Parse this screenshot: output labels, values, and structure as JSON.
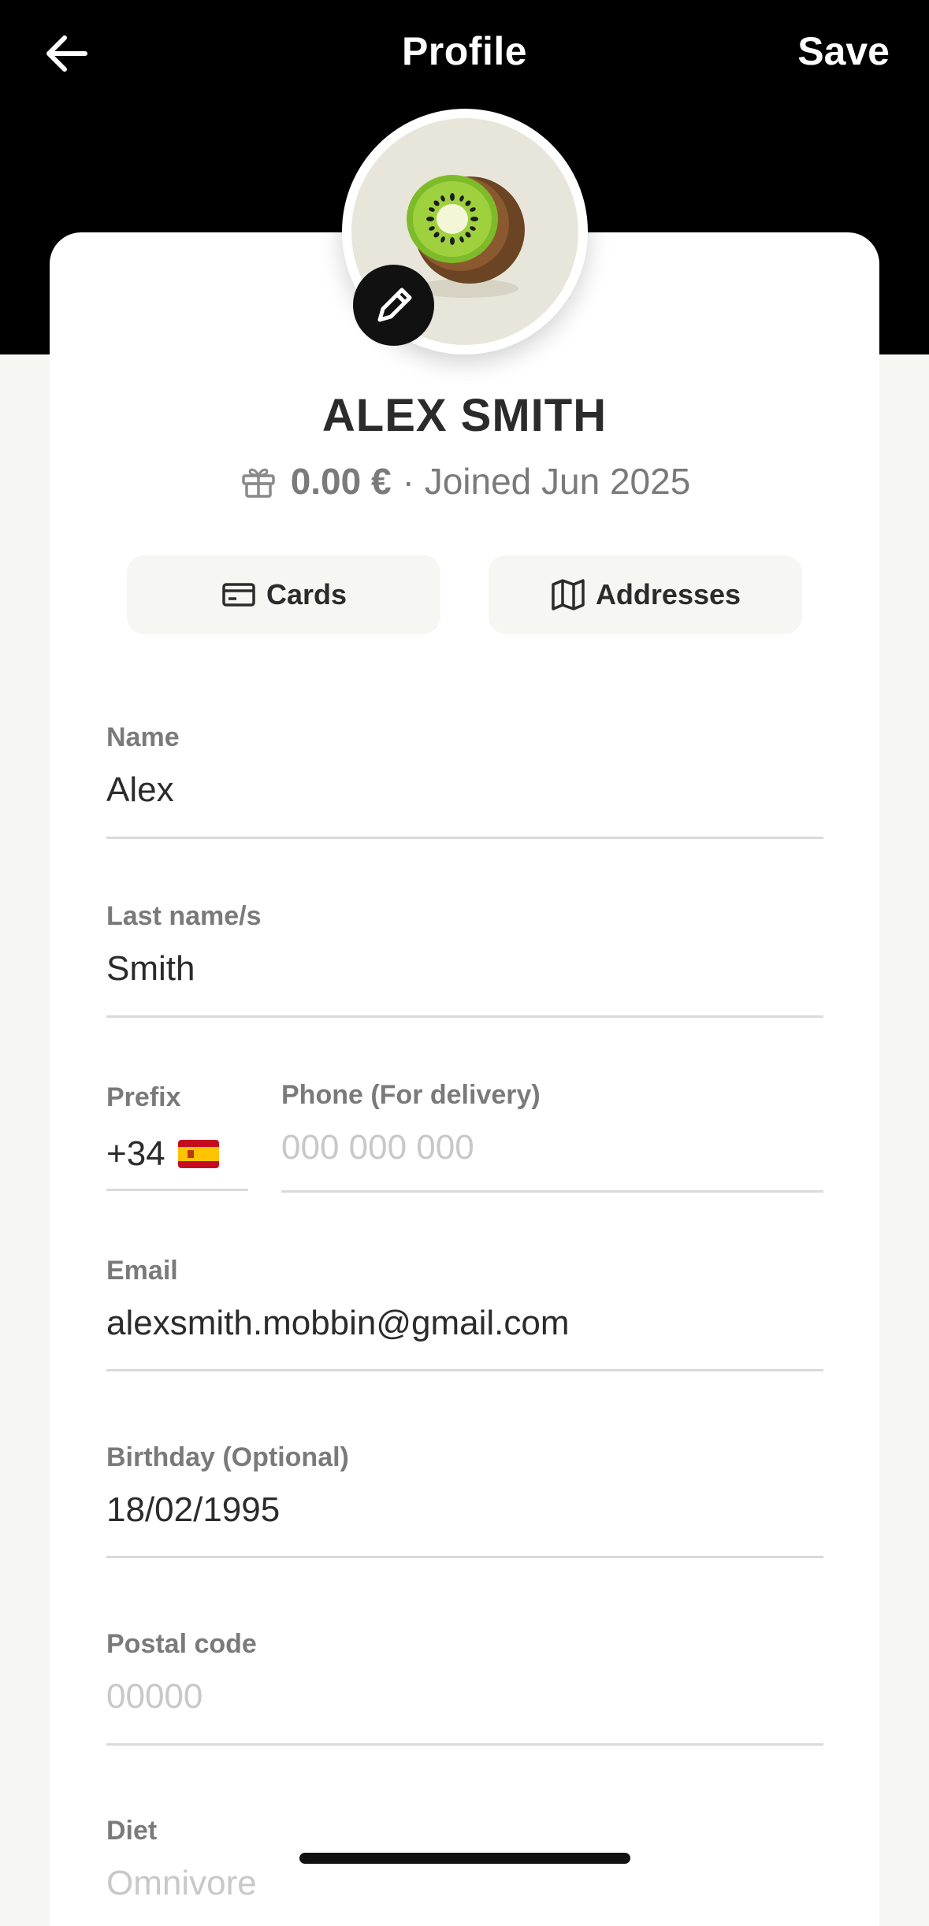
{
  "nav": {
    "title": "Profile",
    "save_label": "Save"
  },
  "profile": {
    "name": "ALEX SMITH",
    "balance": "0.00 €",
    "joined": "· Joined Jun 2025"
  },
  "chips": {
    "cards_label": "Cards",
    "addresses_label": "Addresses"
  },
  "form": {
    "name": {
      "label": "Name",
      "value": "Alex"
    },
    "last_name": {
      "label": "Last name/s",
      "value": "Smith"
    },
    "prefix": {
      "label": "Prefix",
      "value": "+34"
    },
    "phone": {
      "label": "Phone (For delivery)",
      "placeholder": "000 000 000"
    },
    "email": {
      "label": "Email",
      "value": "alexsmith.mobbin@gmail.com"
    },
    "birthday": {
      "label": "Birthday (Optional)",
      "value": "18/02/1995"
    },
    "postal_code": {
      "label": "Postal code",
      "placeholder": "00000"
    },
    "diet": {
      "label": "Diet",
      "placeholder": "Omnivore"
    }
  },
  "colors": {
    "header_bg": "#000000",
    "page_bg": "#f6f6f2",
    "text": "#2b2b2b",
    "muted": "#7a7a7a",
    "placeholder": "#c8c8c8"
  },
  "icons": {
    "back": "arrow-left-icon",
    "edit": "pencil-icon",
    "gift": "gift-icon",
    "cards": "credit-card-icon",
    "addresses": "map-icon",
    "flag": "spain-flag-icon"
  }
}
